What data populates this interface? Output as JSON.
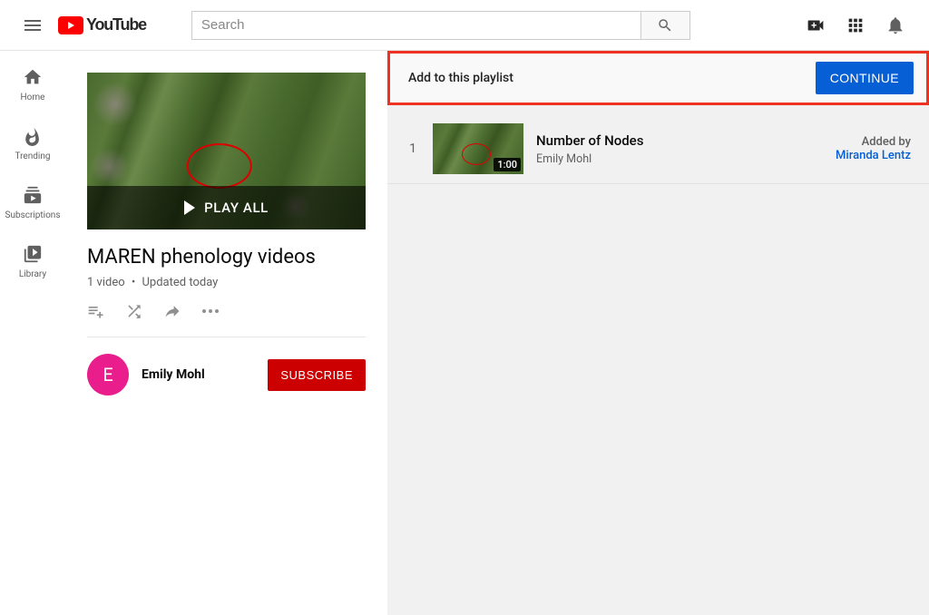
{
  "header": {
    "search_placeholder": "Search",
    "logo_text": "YouTube"
  },
  "sidebar": {
    "items": [
      {
        "label": "Home"
      },
      {
        "label": "Trending"
      },
      {
        "label": "Subscriptions"
      },
      {
        "label": "Library"
      }
    ]
  },
  "playlist": {
    "play_all_label": "PLAY ALL",
    "title": "MAREN phenology videos",
    "video_count": "1 video",
    "updated": "Updated today",
    "owner": {
      "initial": "E",
      "name": "Emily Mohl"
    },
    "subscribe_label": "SUBSCRIBE"
  },
  "prompt": {
    "text": "Add to this playlist",
    "continue_label": "CONTINUE"
  },
  "videos": [
    {
      "index": "1",
      "duration": "1:00",
      "title": "Number of Nodes",
      "author": "Emily Mohl",
      "added_by_label": "Added by",
      "added_by": "Miranda Lentz"
    }
  ]
}
